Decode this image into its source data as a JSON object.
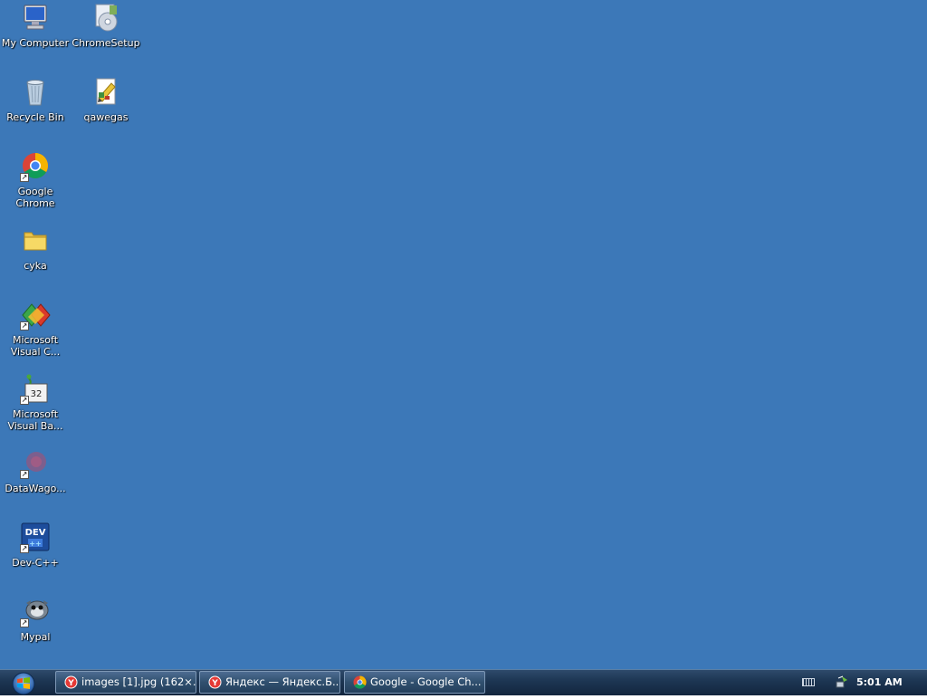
{
  "desktop": {
    "icons": [
      {
        "label": "My Computer",
        "icon": "my-computer-icon"
      },
      {
        "label": "ChromeSetup",
        "icon": "chrome-setup-icon"
      },
      {
        "label": "Recycle Bin",
        "icon": "recycle-bin-icon"
      },
      {
        "label": "qawegas",
        "icon": "image-file-icon"
      },
      {
        "label": "Google Chrome",
        "icon": "chrome-icon"
      },
      {
        "label": "cyka",
        "icon": "folder-icon"
      },
      {
        "label": "Microsoft Visual C...",
        "icon": "visual-cpp-icon"
      },
      {
        "label": "Microsoft Visual Ba...",
        "icon": "visual-basic-icon"
      },
      {
        "label": "DataWago...",
        "icon": "datawagon-icon"
      },
      {
        "label": "Dev-C++",
        "icon": "dev-cpp-icon"
      },
      {
        "label": "Mypal",
        "icon": "mypal-icon"
      }
    ]
  },
  "taskbar": {
    "start_label": "Start",
    "tasks": [
      {
        "label": "images [1].jpg (162×...",
        "icon": "yandex-icon"
      },
      {
        "label": "Яндекс — Яндекс.Б...",
        "icon": "yandex-icon"
      },
      {
        "label": "Google - Google Ch...",
        "icon": "chrome-icon"
      }
    ],
    "tray": {
      "clock": "5:01 AM"
    }
  },
  "colors": {
    "desktop_bg": "#3c78b8",
    "taskbar_bg": "#1c3552"
  }
}
